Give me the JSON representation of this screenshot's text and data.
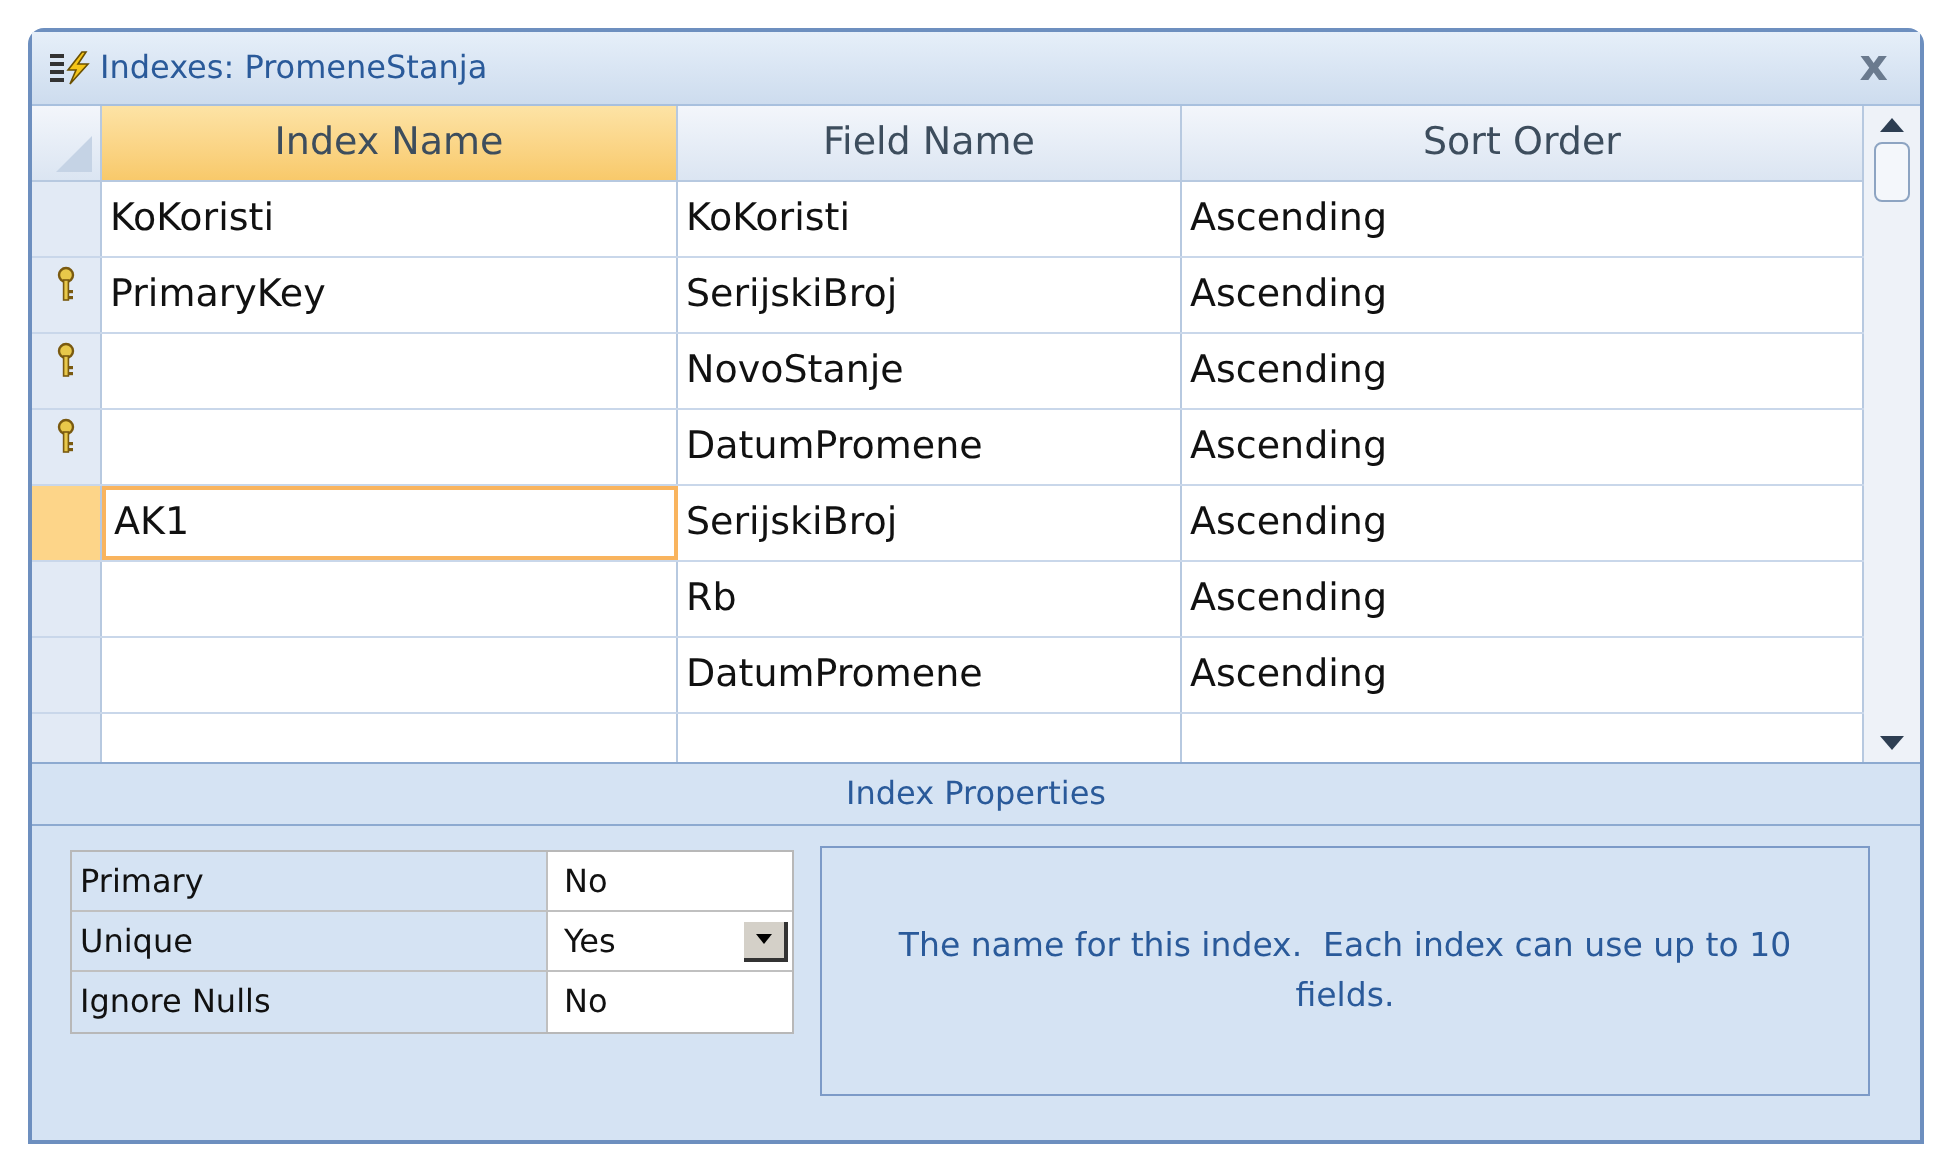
{
  "window": {
    "title": "Indexes: PromeneStanja",
    "close": "x"
  },
  "table": {
    "columns": [
      "Index Name",
      "Field Name",
      "Sort Order"
    ],
    "rows": [
      {
        "index_name": "KoKoristi",
        "field_name": "KoKoristi",
        "sort_order": "Ascending",
        "primary_key": false,
        "selected": false
      },
      {
        "index_name": "PrimaryKey",
        "field_name": "SerijskiBroj",
        "sort_order": "Ascending",
        "primary_key": true,
        "selected": false
      },
      {
        "index_name": "",
        "field_name": "NovoStanje",
        "sort_order": "Ascending",
        "primary_key": true,
        "selected": false
      },
      {
        "index_name": "",
        "field_name": "DatumPromene",
        "sort_order": "Ascending",
        "primary_key": true,
        "selected": false
      },
      {
        "index_name": "AK1",
        "field_name": "SerijskiBroj",
        "sort_order": "Ascending",
        "primary_key": false,
        "selected": true
      },
      {
        "index_name": "",
        "field_name": "Rb",
        "sort_order": "Ascending",
        "primary_key": false,
        "selected": false
      },
      {
        "index_name": "",
        "field_name": "DatumPromene",
        "sort_order": "Ascending",
        "primary_key": false,
        "selected": false
      }
    ]
  },
  "properties": {
    "title": "Index Properties",
    "items": [
      {
        "label": "Primary",
        "value": "No",
        "kind": "text"
      },
      {
        "label": "Unique",
        "value": "Yes",
        "kind": "dropdown"
      },
      {
        "label": "Ignore Nulls",
        "value": "No",
        "kind": "text"
      }
    ],
    "help": "The name for this index.  Each index can use up to 10 fields."
  }
}
